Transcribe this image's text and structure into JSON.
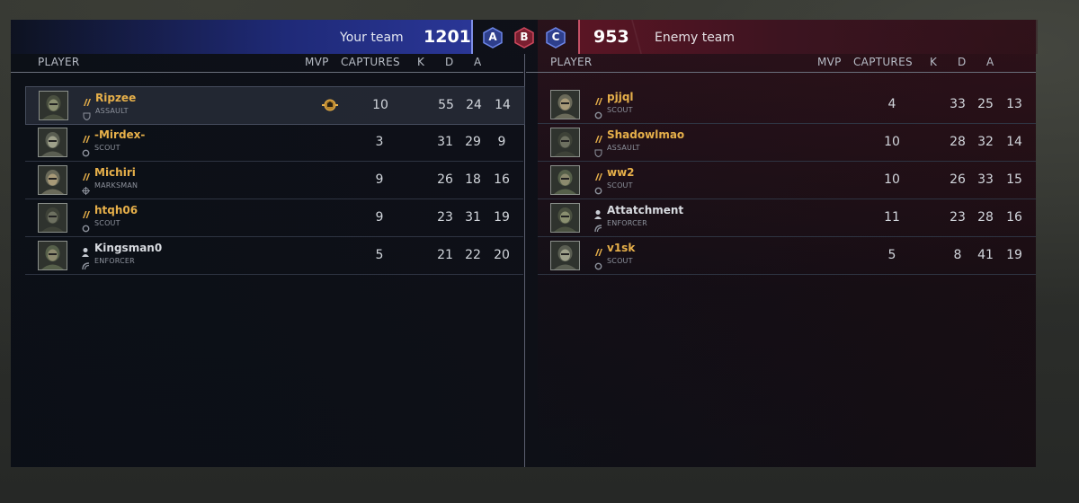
{
  "header": {
    "your_team_label": "Your team",
    "your_score": "1201",
    "enemy_team_label": "Enemy team",
    "enemy_score": "953",
    "objectives": [
      {
        "label": "A",
        "color": "#3a5bd0"
      },
      {
        "label": "B",
        "color": "#b8344a"
      },
      {
        "label": "C",
        "color": "#3a5bd0"
      }
    ]
  },
  "columns": {
    "player": "PLAYER",
    "mvp": "MVP",
    "captures": "CAPTURES",
    "k": "K",
    "d": "D",
    "a": "A"
  },
  "colors": {
    "gold_name": "#e7b04a",
    "plain_name": "#d8dbe0",
    "friendly_accent": "#2a3696",
    "enemy_accent": "#5a1524"
  },
  "your_team": [
    {
      "name": "Ripzee",
      "class": "ASSAULT",
      "class_icon": "shield-icon",
      "rank_icon": "rank-chevrons-icon",
      "mvp": true,
      "captures": "10",
      "k": "55",
      "d": "24",
      "a": "14",
      "highlight": true
    },
    {
      "name": "-Mirdex-",
      "class": "SCOUT",
      "class_icon": "ring-icon",
      "rank_icon": "rank-chevrons-icon",
      "mvp": false,
      "captures": "3",
      "k": "31",
      "d": "29",
      "a": "9"
    },
    {
      "name": "Michiri",
      "class": "MARKSMAN",
      "class_icon": "crosshair-icon",
      "rank_icon": "rank-chevrons-icon",
      "mvp": false,
      "captures": "9",
      "k": "26",
      "d": "18",
      "a": "16"
    },
    {
      "name": "htqh06",
      "class": "SCOUT",
      "class_icon": "ring-icon",
      "rank_icon": "rank-chevrons-icon",
      "mvp": false,
      "captures": "9",
      "k": "23",
      "d": "31",
      "a": "19"
    },
    {
      "name": "Kingsman0",
      "class": "ENFORCER",
      "class_icon": "enforcer-icon",
      "rank_icon": "person-icon",
      "mvp": false,
      "captures": "5",
      "k": "21",
      "d": "22",
      "a": "20"
    }
  ],
  "enemy_team": [
    {
      "name": "pjjql",
      "class": "SCOUT",
      "class_icon": "ring-icon",
      "rank_icon": "rank-chevrons-icon",
      "captures": "4",
      "k": "33",
      "d": "25",
      "a": "13"
    },
    {
      "name": "Shadowlmao",
      "class": "ASSAULT",
      "class_icon": "shield-icon",
      "rank_icon": "rank-chevrons-icon",
      "captures": "10",
      "k": "28",
      "d": "32",
      "a": "14"
    },
    {
      "name": "ww2",
      "class": "SCOUT",
      "class_icon": "ring-icon",
      "rank_icon": "rank-chevrons-icon",
      "captures": "10",
      "k": "26",
      "d": "33",
      "a": "15"
    },
    {
      "name": "Attatchment",
      "class": "ENFORCER",
      "class_icon": "enforcer-icon",
      "rank_icon": "person-icon",
      "captures": "11",
      "k": "23",
      "d": "28",
      "a": "16"
    },
    {
      "name": "v1sk",
      "class": "SCOUT",
      "class_icon": "ring-icon",
      "rank_icon": "rank-chevrons-icon",
      "captures": "5",
      "k": "8",
      "d": "41",
      "a": "19"
    }
  ]
}
